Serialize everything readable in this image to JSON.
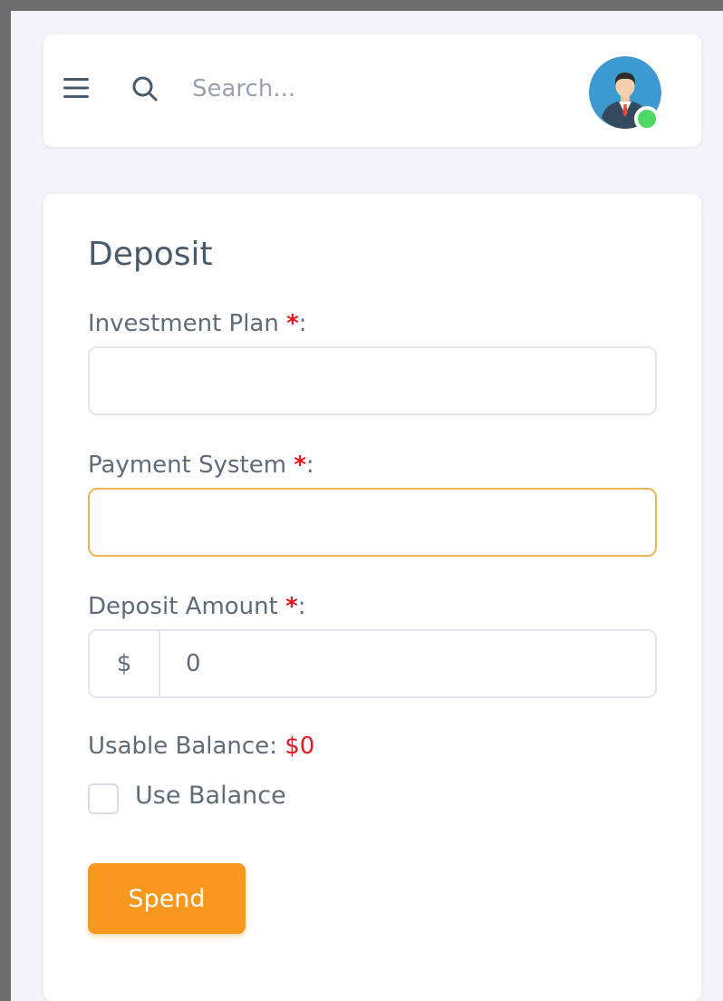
{
  "header": {
    "menu_icon": "hamburger-menu-icon",
    "search_icon": "magnifier-icon",
    "search": {
      "placeholder": "Search...",
      "value": ""
    },
    "avatar": {
      "icon": "user-avatar-businessman",
      "status": "online",
      "status_color": "#4cd964"
    }
  },
  "deposit_form": {
    "title": "Deposit",
    "required_mark": "*",
    "label_suffix": ":",
    "investment_plan": {
      "label": "Investment Plan",
      "value": ""
    },
    "payment_system": {
      "label": "Payment System",
      "value": "",
      "focused": true
    },
    "deposit_amount": {
      "label": "Deposit Amount",
      "currency_symbol": "$",
      "value": "0"
    },
    "balance": {
      "label": "Usable Balance:",
      "value": "$0"
    },
    "use_balance": {
      "label": "Use Balance",
      "checked": false
    },
    "submit_label": "Spend"
  },
  "colors": {
    "page_background": "#f3f3f9",
    "card_background": "#ffffff",
    "accent_button": "#f7971e",
    "required_mark": "#e5171c",
    "balance_value": "#e5171c",
    "focus_border": "#e8b659",
    "avatar_background": "#3d9ad1"
  }
}
